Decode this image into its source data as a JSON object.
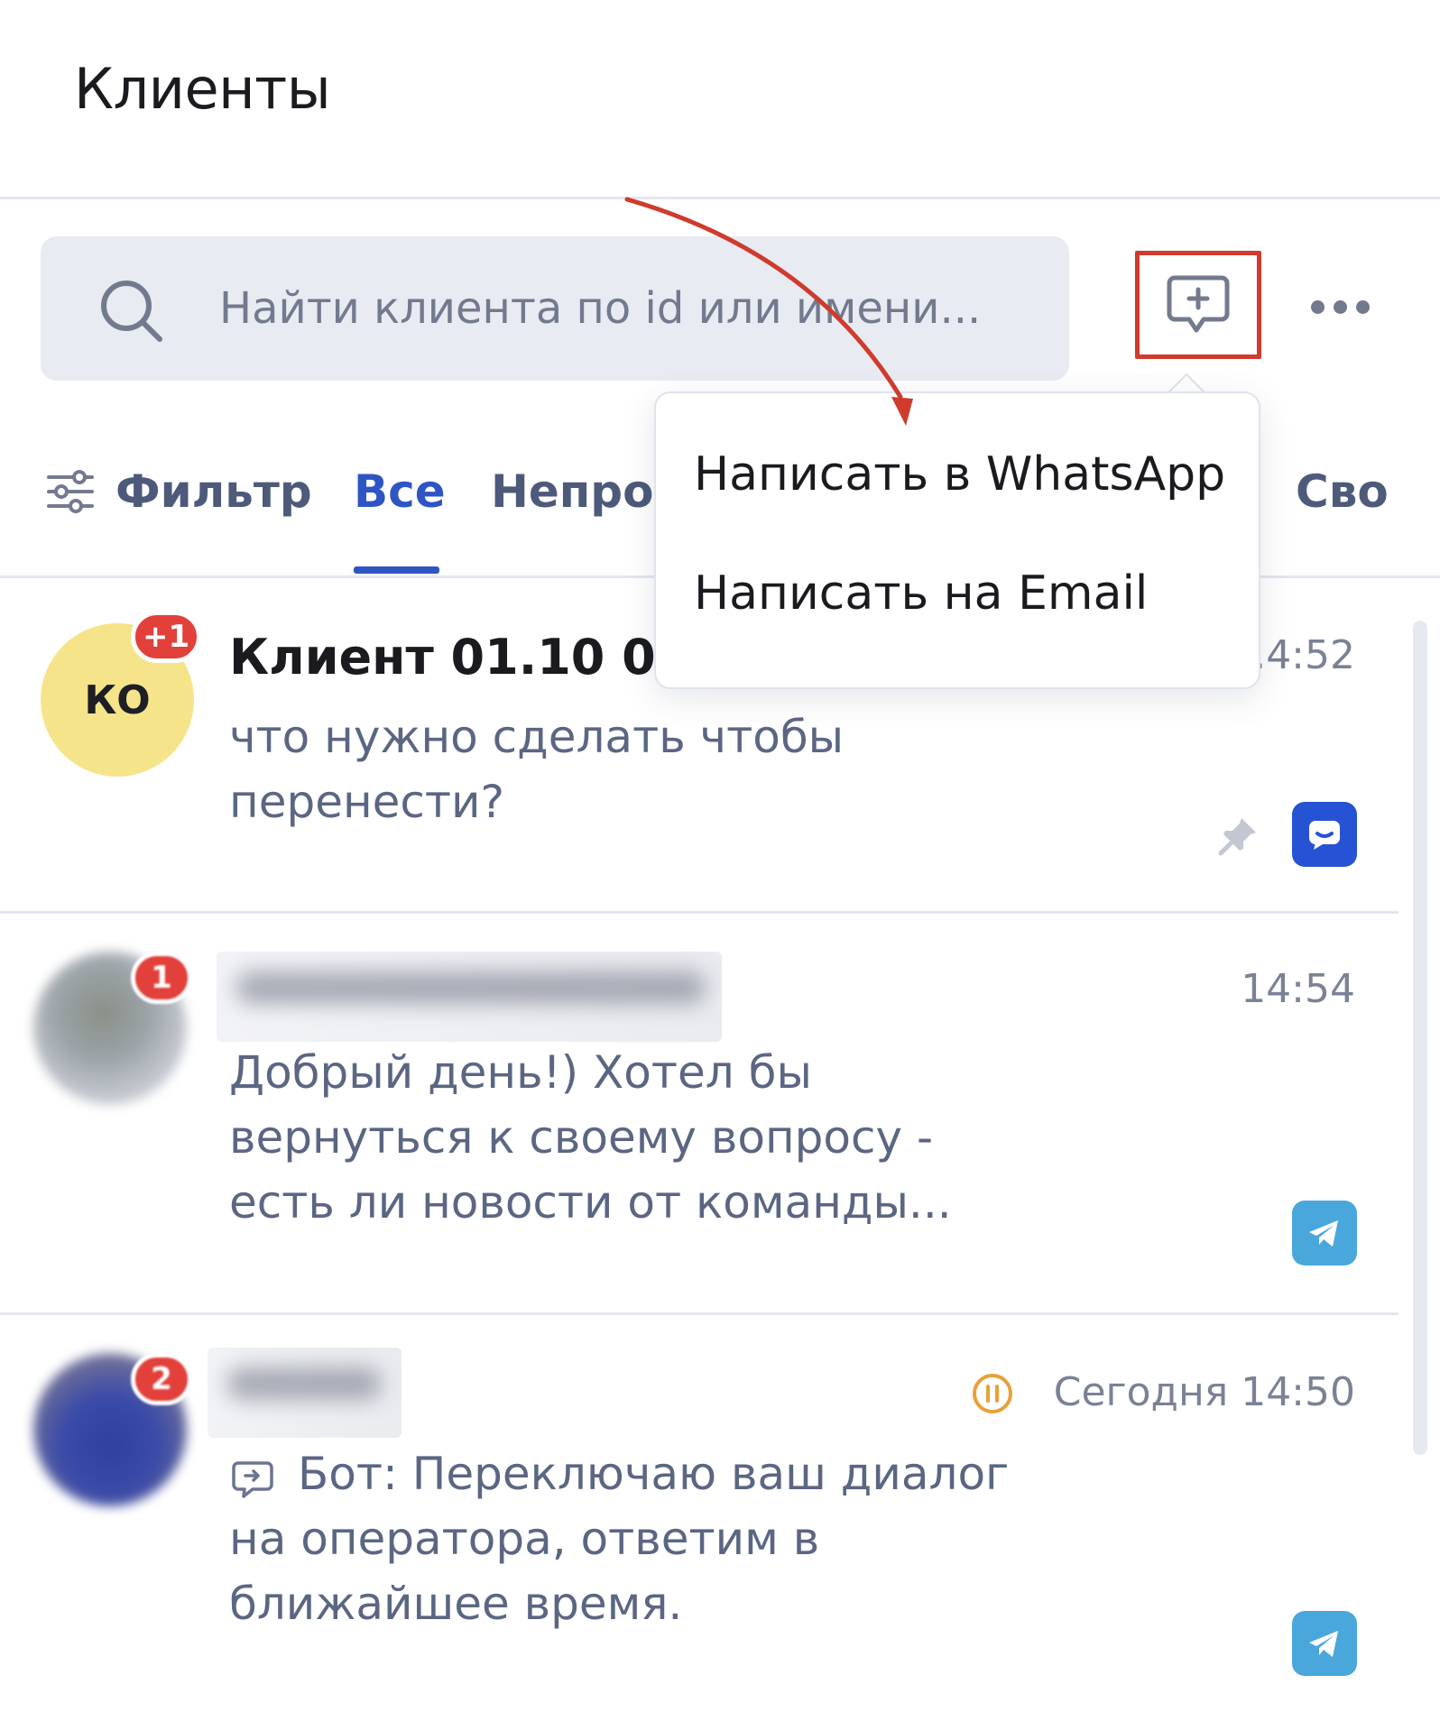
{
  "header": {
    "title": "Клиенты"
  },
  "search": {
    "placeholder": "Найти клиента по id или имени..."
  },
  "toolbar": {
    "new_chat_icon": "chat-plus-icon",
    "more_icon": "more-horizontal-icon"
  },
  "tabs": {
    "filter_label": "Фильтр",
    "items": [
      {
        "label": "Все",
        "active": true
      },
      {
        "label": "Непро"
      },
      {
        "label": "Сво"
      }
    ]
  },
  "dropdown": {
    "items": [
      {
        "label": "Написать в WhatsApp"
      },
      {
        "label": "Написать на Email"
      }
    ]
  },
  "conversations": [
    {
      "avatar_initials": "КО",
      "badge": "+1",
      "name": "Клиент 01.10 00",
      "time": ".4:52",
      "preview": "что нужно сделать чтобы\nперенести?",
      "pinned": true,
      "channel": "chat-icon"
    },
    {
      "badge": "1",
      "time": "14:54",
      "preview": "Добрый день!) Хотел бы\nвернуться к своему вопросу -\nесть ли новости от команды...",
      "channel": "telegram-icon"
    },
    {
      "badge": "2",
      "time": "Сегодня 14:50",
      "status_icon": "pause-icon",
      "preview": "Бот: Переключаю ваш диалог\nна оператора, ответим в\nближайшее время.",
      "bot_icon": "bot-icon",
      "channel": "telegram-icon"
    }
  ],
  "colors": {
    "accent": "#2f55c4",
    "badge": "#e2403a",
    "highlight": "#cf3b2c",
    "pause": "#e8a13a"
  }
}
